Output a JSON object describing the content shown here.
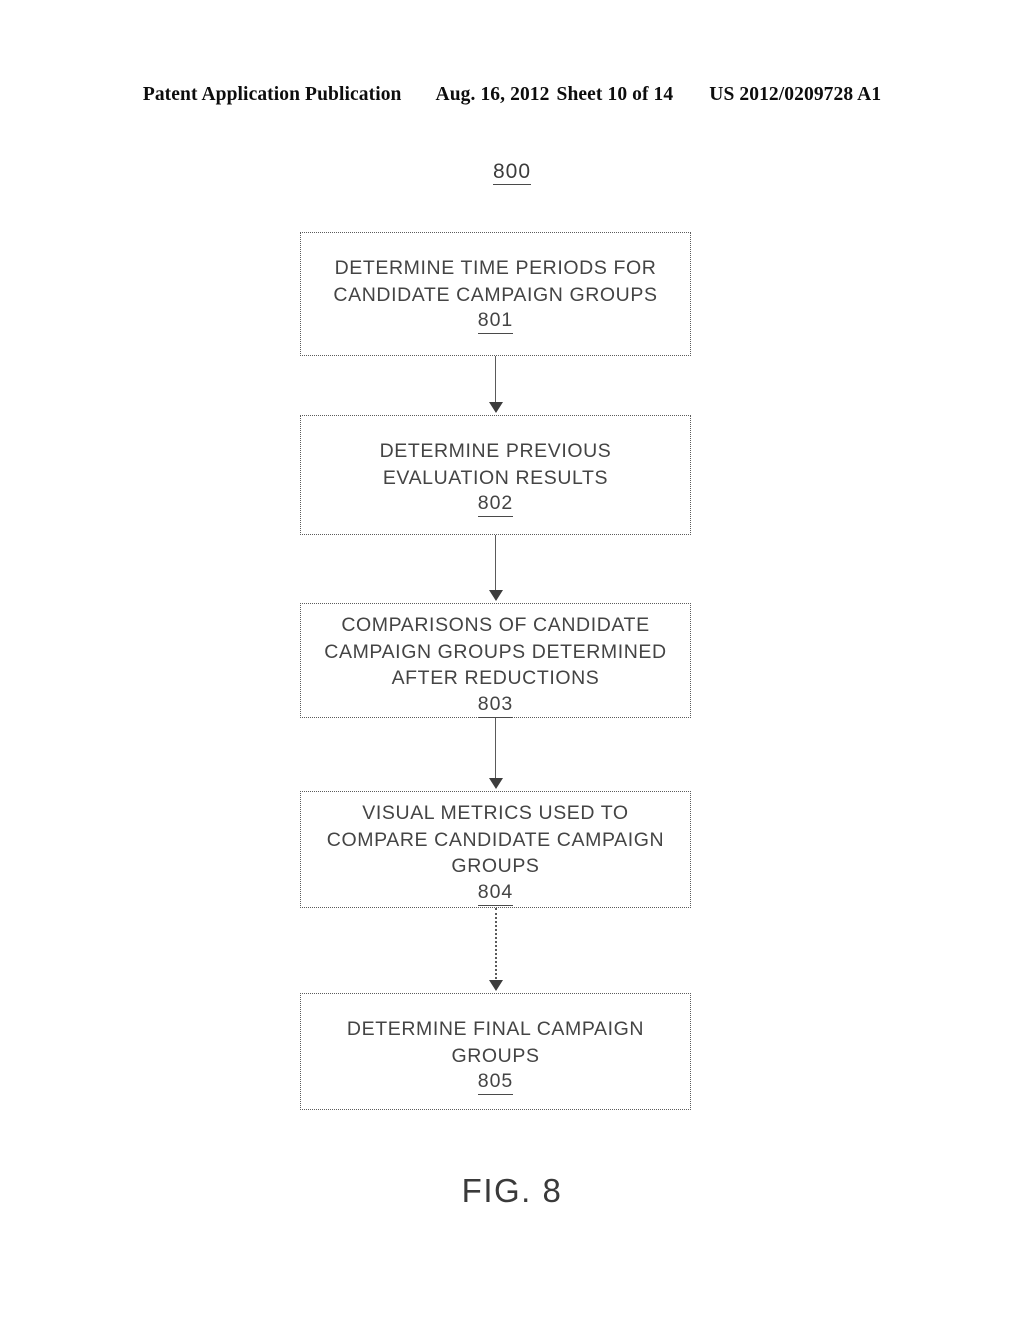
{
  "header": {
    "publication": "Patent Application Publication",
    "date": "Aug. 16, 2012",
    "sheet": "Sheet 10 of 14",
    "patent_number": "US 2012/0209728 A1"
  },
  "figure": {
    "reference_number": "800",
    "caption": "FIG. 8"
  },
  "flowchart": {
    "steps": [
      {
        "id": "801",
        "text": "DETERMINE TIME PERIODS FOR\nCANDIDATE CAMPAIGN GROUPS",
        "number": "801"
      },
      {
        "id": "802",
        "text": "DETERMINE PREVIOUS\nEVALUATION RESULTS",
        "number": "802"
      },
      {
        "id": "803",
        "text": "COMPARISONS OF CANDIDATE\nCAMPAIGN GROUPS DETERMINED\nAFTER REDUCTIONS",
        "number": "803"
      },
      {
        "id": "804",
        "text": "VISUAL METRICS USED TO\nCOMPARE CANDIDATE CAMPAIGN\nGROUPS",
        "number": "804"
      },
      {
        "id": "805",
        "text": "DETERMINE FINAL CAMPAIGN\nGROUPS",
        "number": "805"
      }
    ],
    "connectors": [
      {
        "from": "801",
        "to": "802",
        "style": "solid"
      },
      {
        "from": "802",
        "to": "803",
        "style": "solid"
      },
      {
        "from": "803",
        "to": "804",
        "style": "solid"
      },
      {
        "from": "804",
        "to": "805",
        "style": "dotted"
      }
    ]
  },
  "colors": {
    "ink": "#3d3d3d",
    "box_border": "#5c5c5c",
    "page_background": "#ffffff"
  }
}
